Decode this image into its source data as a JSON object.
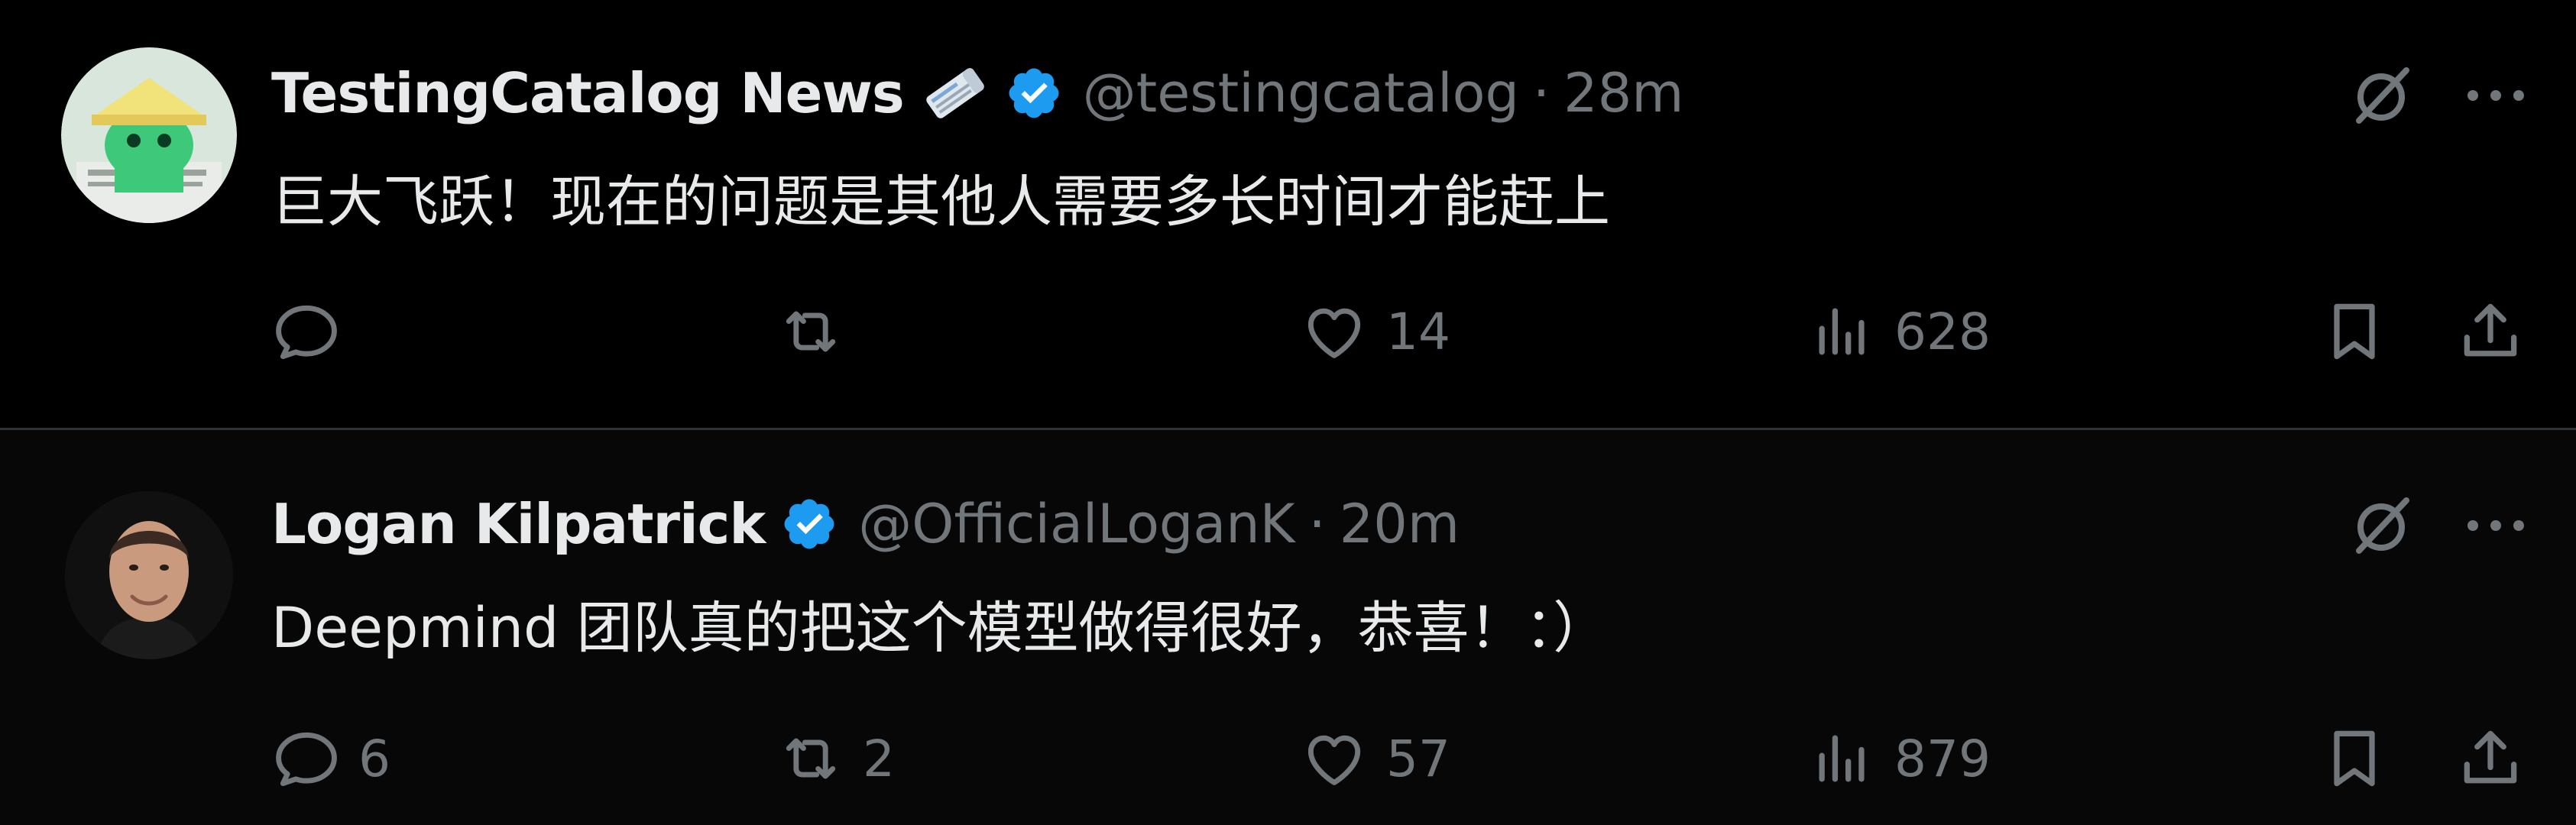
{
  "tweets": [
    {
      "author_name": "TestingCatalog News",
      "handle": "@testingcatalog",
      "separator": "·",
      "time": "28m",
      "text": "巨大飞跃！现在的问题是其他人需要多长时间才能赶上",
      "reply_count": "",
      "retweet_count": "",
      "like_count": "14",
      "view_count": "628"
    },
    {
      "author_name": "Logan Kilpatrick",
      "handle": "@OfficialLoganK",
      "separator": "·",
      "time": "20m",
      "text": "Deepmind 团队真的把这个模型做得很好，恭喜！：）",
      "reply_count": "6",
      "retweet_count": "2",
      "like_count": "57",
      "view_count": "879"
    }
  ],
  "icons": {
    "reply": "reply-icon",
    "retweet": "retweet-icon",
    "like": "heart-icon",
    "views": "views-icon",
    "bookmark": "bookmark-icon",
    "share": "share-icon",
    "grok": "grok-icon",
    "more": "more-icon",
    "verified": "verified-badge-icon",
    "emoji": "newspaper-emoji-icon"
  },
  "colors": {
    "background": "#000000",
    "text_primary": "#e7e9ea",
    "text_secondary": "#71767b",
    "verified": "#1d9bf0",
    "divider": "#2f3336"
  }
}
